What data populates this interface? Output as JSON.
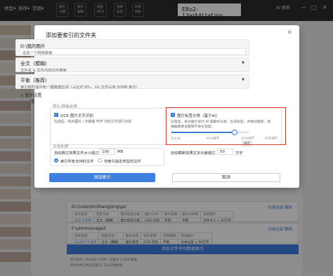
{
  "topbar": {
    "menus": [
      "类型▾",
      "排序▾",
      "范围▾"
    ],
    "chips": [
      {
        "l1": "图片",
        "l2": "大图"
      },
      {
        "l1": "照片",
        "l2": "缩略"
      },
      {
        "l1": "类型",
        "l2": "JPEG"
      },
      {
        "l1": "选择",
        "l2": "多选"
      },
      {
        "l1": "标签",
        "l2": "列表"
      }
    ],
    "filename": "E8o2-13alAALtaf.jpg",
    "ai_search": "AI 搜索",
    "win_buttons": [
      "—",
      "□",
      "✕"
    ]
  },
  "background": {
    "side_labels": [
      "设",
      "包",
      "包",
      "包"
    ],
    "folders": [
      {
        "path": "D:\\Code\\ShiShang\\img\\pic",
        "actions": "扫描全部  删除",
        "rows": [
          [
            "索引状态",
            "检索方式",
            "图片标签分类",
            "图片OCR",
            "照片说明",
            "图片分辨率",
            "其他图片"
          ],
          [
            "311 个文件",
            "全文（模糊）",
            "图片标签分类",
            "OCR 识别",
            "开启",
            "平衡",
            "文件大小 < 50万字"
          ],
          [
            "< 100,000MB",
            "",
            "",
            "",
            "",
            "",
            ""
          ]
        ]
      },
      {
        "path": "F:\\ulmm\\image2",
        "actions": "扫描全部  删除",
        "rows": [
          [
            "检索完成",
            "检索方式",
            "图片标签",
            "照片说明",
            "空间预算",
            "其他图片"
          ],
          [
            "15,917 个文件",
            "全文（模糊）",
            "图片标签",
            "OCR 识别",
            "平衡",
            "文本长度 < 50万字"
          ],
          [
            "< 100,000MB",
            "",
            "",
            "",
            "",
            ""
          ]
        ]
      }
    ],
    "add_folder": "添加文件夹到数据索引",
    "footer_lines": [
      "索引统计: 28,000 个文件 / 已索引 1.2GB 数据",
      "所有文件已经完成索引, 可以开始搜索"
    ]
  },
  "dialog": {
    "title": "添加要索引的文件夹",
    "close": "✕",
    "folder": {
      "path": "D:\\我的图片",
      "placeholder": "这是一个网络磁盘"
    },
    "search_mode": {
      "value": "全文（模糊）",
      "desc": "文件名 & 文件内容均可搜索"
    },
    "balance": {
      "value": "平衡（推荐）",
      "desc": "索引耗时适中和一键磁盘空间（占比约 8%，1G 文件占用 50MB 索引）"
    },
    "collapse_label": "∧  更多设置",
    "image_section": {
      "label": "图片/图像处理",
      "ocr": {
        "title": "OCR 图片文字识别",
        "desc": "勾选后，将对图片 / 扫描版 PDF 内的文字进行识别"
      },
      "ai_tag": {
        "title": "图片标签分类（基于AI）",
        "desc1": "勾选后，将对图片进行 AI 理解并分类，生成标签，并做创建索。请",
        "desc2": "根据需要设置细节体化程度。",
        "ticks": [
          "仅主体",
          "30%细节",
          "60%细节",
          "所有细节"
        ],
        "selected_tick": "推荐",
        "level": 0.82
      }
    },
    "text_section": {
      "label": "文本处理",
      "skip_size_label": "自动跳过如果文件大小超过",
      "skip_size_value": "100",
      "skip_size_unit": "MB",
      "truncate_label": "自动截断如果文本长度超过",
      "truncate_value": "50",
      "truncate_unit": "万字",
      "radio_all": "索引所有支持的文件",
      "radio_specific": "仅索引指定类型的文件"
    },
    "buttons": {
      "confirm": "添加索引",
      "cancel": "取消"
    }
  }
}
